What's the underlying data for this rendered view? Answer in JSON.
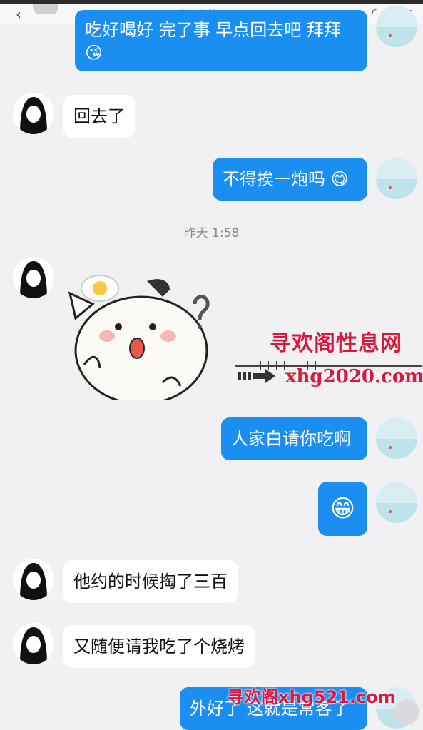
{
  "status_bar": {
    "online_text": "手机在线 - WiFi >"
  },
  "messages": {
    "m1_text": "吃好喝好 完了事 早点回去吧 拜拜",
    "m2_text": "回去了",
    "m3_text": "不得挨一炮吗",
    "timestamp": "昨天 1:58",
    "m5_text": "人家白请你吃啊",
    "m7_text": "他约的时候掏了三百",
    "m8_text": "又随便请我吃了个烧烤",
    "m9_text": "外好了 这就是常客了"
  },
  "watermarks": {
    "site_name": "寻欢阁性息网",
    "site_url": "xhg2020.com",
    "bottom_banner": "寻欢阁xhg521.com"
  },
  "colors": {
    "accent": "#1b8ef2",
    "watermark": "#d8193b",
    "online": "#2ecc71"
  }
}
